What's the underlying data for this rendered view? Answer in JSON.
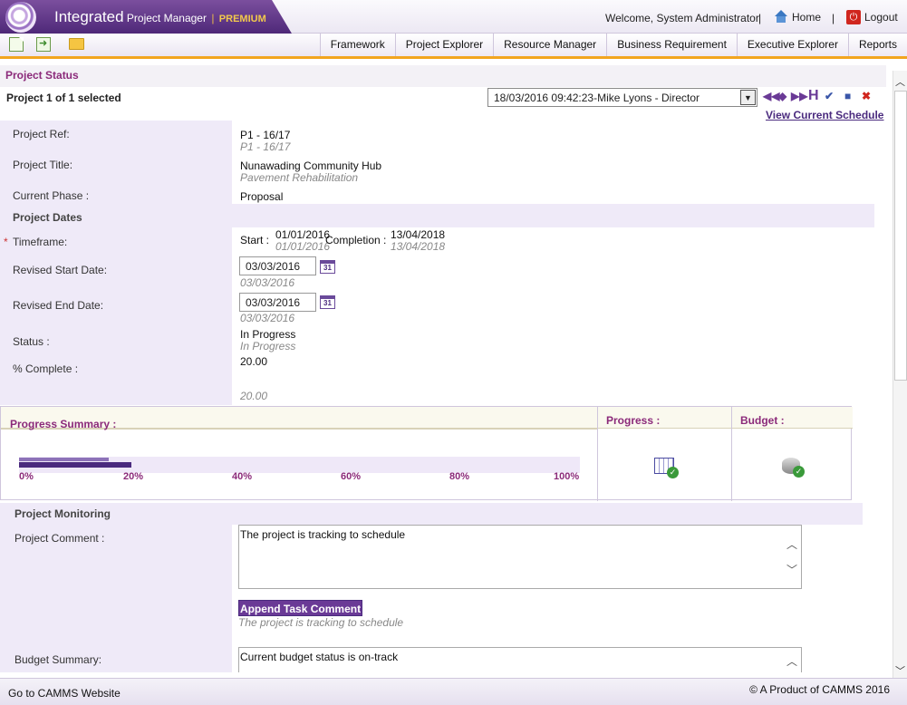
{
  "header": {
    "brand_main": "Integrated",
    "brand_project": "Project",
    "brand_manager": "Manager",
    "brand_sep": "|",
    "brand_premium": "PREMIUM",
    "welcome": "Welcome, System Administrator",
    "separator": "|",
    "home": "Home",
    "logout": "Logout"
  },
  "toolbar": {
    "icons": [
      "new-document-icon",
      "import-icon",
      "open-folder-icon"
    ]
  },
  "nav": {
    "tabs": [
      "Framework",
      "Project Explorer",
      "Resource Manager",
      "Business Requirement",
      "Executive Explorer",
      "Reports"
    ]
  },
  "page": {
    "section_title": "Project Status",
    "project_count": "Project 1 of 1 selected",
    "schedule_select": "18/03/2016 09:42:23-Mike Lyons - Director",
    "view_schedule": "View Current Schedule",
    "record_buttons": {
      "first": "◀◀",
      "prev": "◆",
      "next": "▶▶",
      "history": "H",
      "spellcheck": "✔",
      "save": "■",
      "close": "✖"
    }
  },
  "fields": {
    "project_ref_label": "Project Ref:",
    "project_ref_value": "P1 - 16/17",
    "project_ref_hist": "P1 - 16/17",
    "project_title_label": "Project Title:",
    "project_title_value": "Nunawading Community Hub",
    "project_title_hist": "Pavement Rehabilitation",
    "current_phase_label": "Current Phase :",
    "current_phase_value": "Proposal",
    "project_dates_heading": "Project Dates",
    "required_marker": "*",
    "timeframe_label": "Timeframe:",
    "start_label": "Start :",
    "start_value": "01/01/2016",
    "start_hist": "01/01/2016",
    "completion_label": "Completion :",
    "completion_value": "13/04/2018",
    "completion_hist": "13/04/2018",
    "revised_start_label": "Revised Start Date:",
    "revised_start_value": "03/03/2016",
    "revised_start_hist": "03/03/2016",
    "revised_end_label": "Revised End Date:",
    "revised_end_value": "03/03/2016",
    "revised_end_hist": "03/03/2016",
    "calendar_glyph": "31",
    "status_label": "Status :",
    "status_value": "In Progress",
    "status_hist": "In Progress",
    "percent_label": "% Complete :",
    "percent_value": "20.00",
    "percent_hist": "20.00"
  },
  "progress_summary": {
    "title": "Progress Summary :",
    "progress_title": "Progress :",
    "budget_title": "Budget :",
    "percent_complete": 20,
    "previous_percent": 16,
    "scale": [
      "0%",
      "20%",
      "40%",
      "60%",
      "80%",
      "100%"
    ]
  },
  "monitoring": {
    "title": "Project Monitoring",
    "comment_label": "Project Comment :",
    "comment_value": "The project is tracking to schedule",
    "append_button": "Append Task Comment",
    "comment_hist": "The project is tracking to schedule",
    "budget_label": "Budget Summary:",
    "budget_value": "Current budget status is on-track"
  },
  "footer": {
    "go_website": "Go to CAMMS Website",
    "product": "© A Product of CAMMS 2016"
  },
  "colors": {
    "brand_purple": "#4e2878",
    "accent_orange": "#f2a51f",
    "label_purple": "#8b2a7a",
    "panel_lavender": "#efeaf8"
  }
}
